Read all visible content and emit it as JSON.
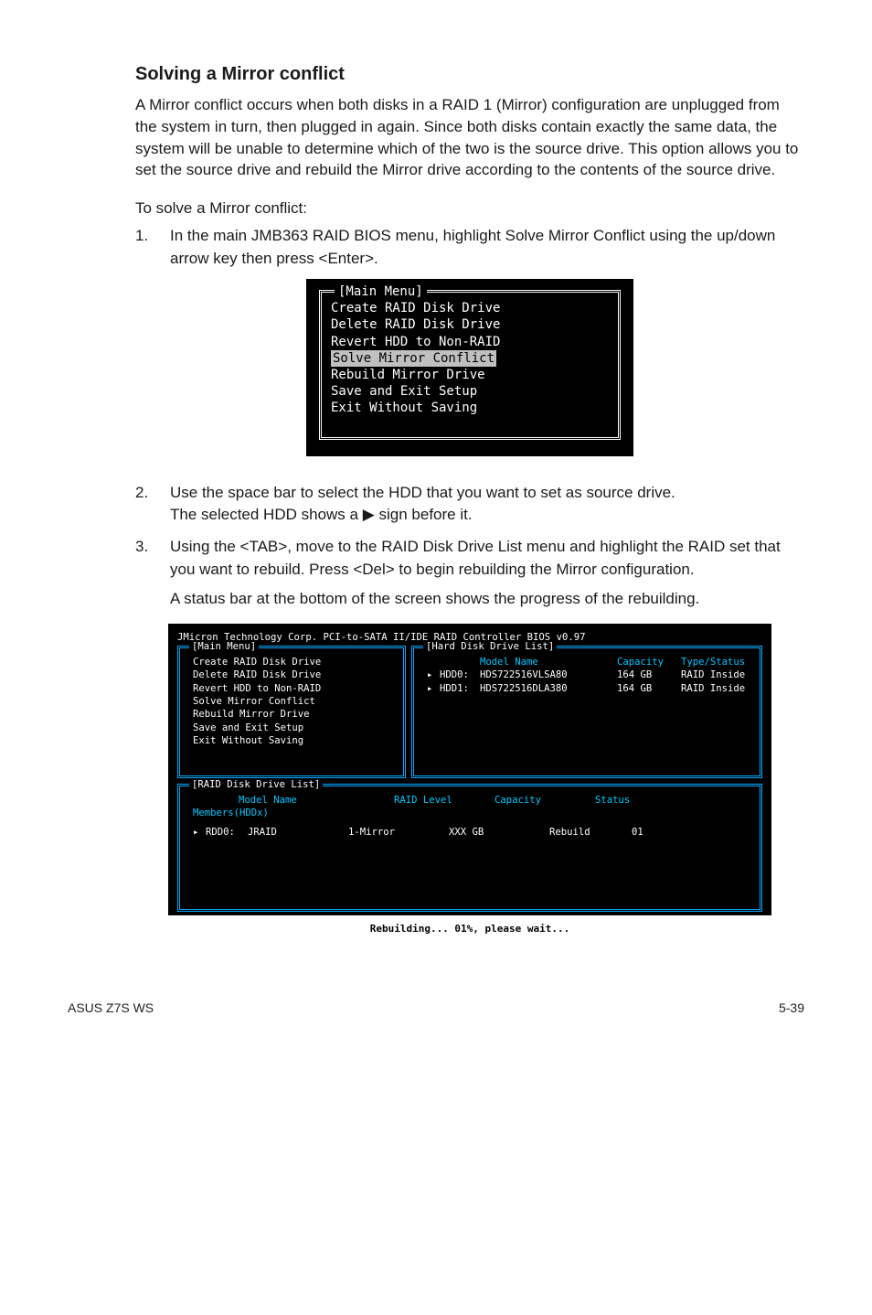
{
  "section_heading": "Solving a Mirror conflict",
  "intro_paragraph": "A Mirror conflict occurs when both disks in a RAID 1 (Mirror) configuration are unplugged from the system in turn, then plugged in again. Since both disks contain exactly the same data, the system will be unable to determine which of the two is the source drive. This option allows you to set the source drive and rebuild the Mirror drive according to the contents of the source drive.",
  "to_solve": "To solve a Mirror conflict:",
  "step1_num": "1.",
  "step1_text": "In the main JMB363 RAID BIOS menu, highlight Solve Mirror Conflict using the up/down arrow key then press <Enter>.",
  "step2_num": "2.",
  "step2_text_a": "Use the space bar to select the HDD that you want to set as source drive.",
  "step2_text_b_pre": "The selected HDD shows a ",
  "step2_text_b_post": " sign before it.",
  "step3_num": "3.",
  "step3_text_a": "Using the <TAB>, move to the RAID Disk Drive List menu and highlight the RAID set that you want to rebuild. Press <Del> to begin rebuilding the Mirror configuration.",
  "step3_text_b": "A status bar at the bottom of the screen shows the progress of the rebuilding.",
  "menu_small": {
    "title": "[Main Menu]",
    "items": {
      "l1": "Create RAID Disk Drive",
      "l2": "Delete RAID Disk Drive",
      "l3": "Revert HDD to Non-RAID",
      "l4": "Solve Mirror Conflict",
      "l5": "Rebuild Mirror Drive",
      "l6": "Save and Exit Setup",
      "l7": "Exit Without Saving"
    }
  },
  "bios": {
    "heading": "JMicron Technology Corp. PCI-to-SATA II/IDE RAID Controller BIOS v0.97",
    "main_title": "[Main Menu]",
    "hdd_title": "[Hard Disk Drive List]",
    "raid_title": "[RAID Disk Drive List]",
    "main_items": {
      "l1": "Create RAID Disk Drive",
      "l2": "Delete RAID Disk Drive",
      "l3": "Revert HDD to Non-RAID",
      "l4": "Solve Mirror Conflict",
      "l5": "Rebuild Mirror Drive",
      "l6": "Save and Exit Setup",
      "l7": "Exit Without Saving"
    },
    "hdd_header": {
      "model": "Model Name",
      "capacity": "Capacity",
      "type": "Type/Status"
    },
    "hdd_rows": {
      "r0": {
        "dev": "HDD0:",
        "model": "HDS722516VLSA80",
        "cap": "164 GB",
        "type": "RAID Inside"
      },
      "r1": {
        "dev": "HDD1:",
        "model": "HDS722516DLA380",
        "cap": "164 GB",
        "type": "RAID Inside"
      }
    },
    "raid_header": {
      "model": "Model Name",
      "level": "RAID Level",
      "capacity": "Capacity",
      "status": "Status"
    },
    "members_label": "Members(HDDx)",
    "raid_row": {
      "dev": "RDD0:",
      "name": "JRAID",
      "level": "1-Mirror",
      "cap": "XXX GB",
      "status": "Rebuild",
      "members": "01"
    },
    "progress": "Rebuilding... 01%, please wait..."
  },
  "footer_left": "ASUS Z7S WS",
  "footer_right": "5-39"
}
